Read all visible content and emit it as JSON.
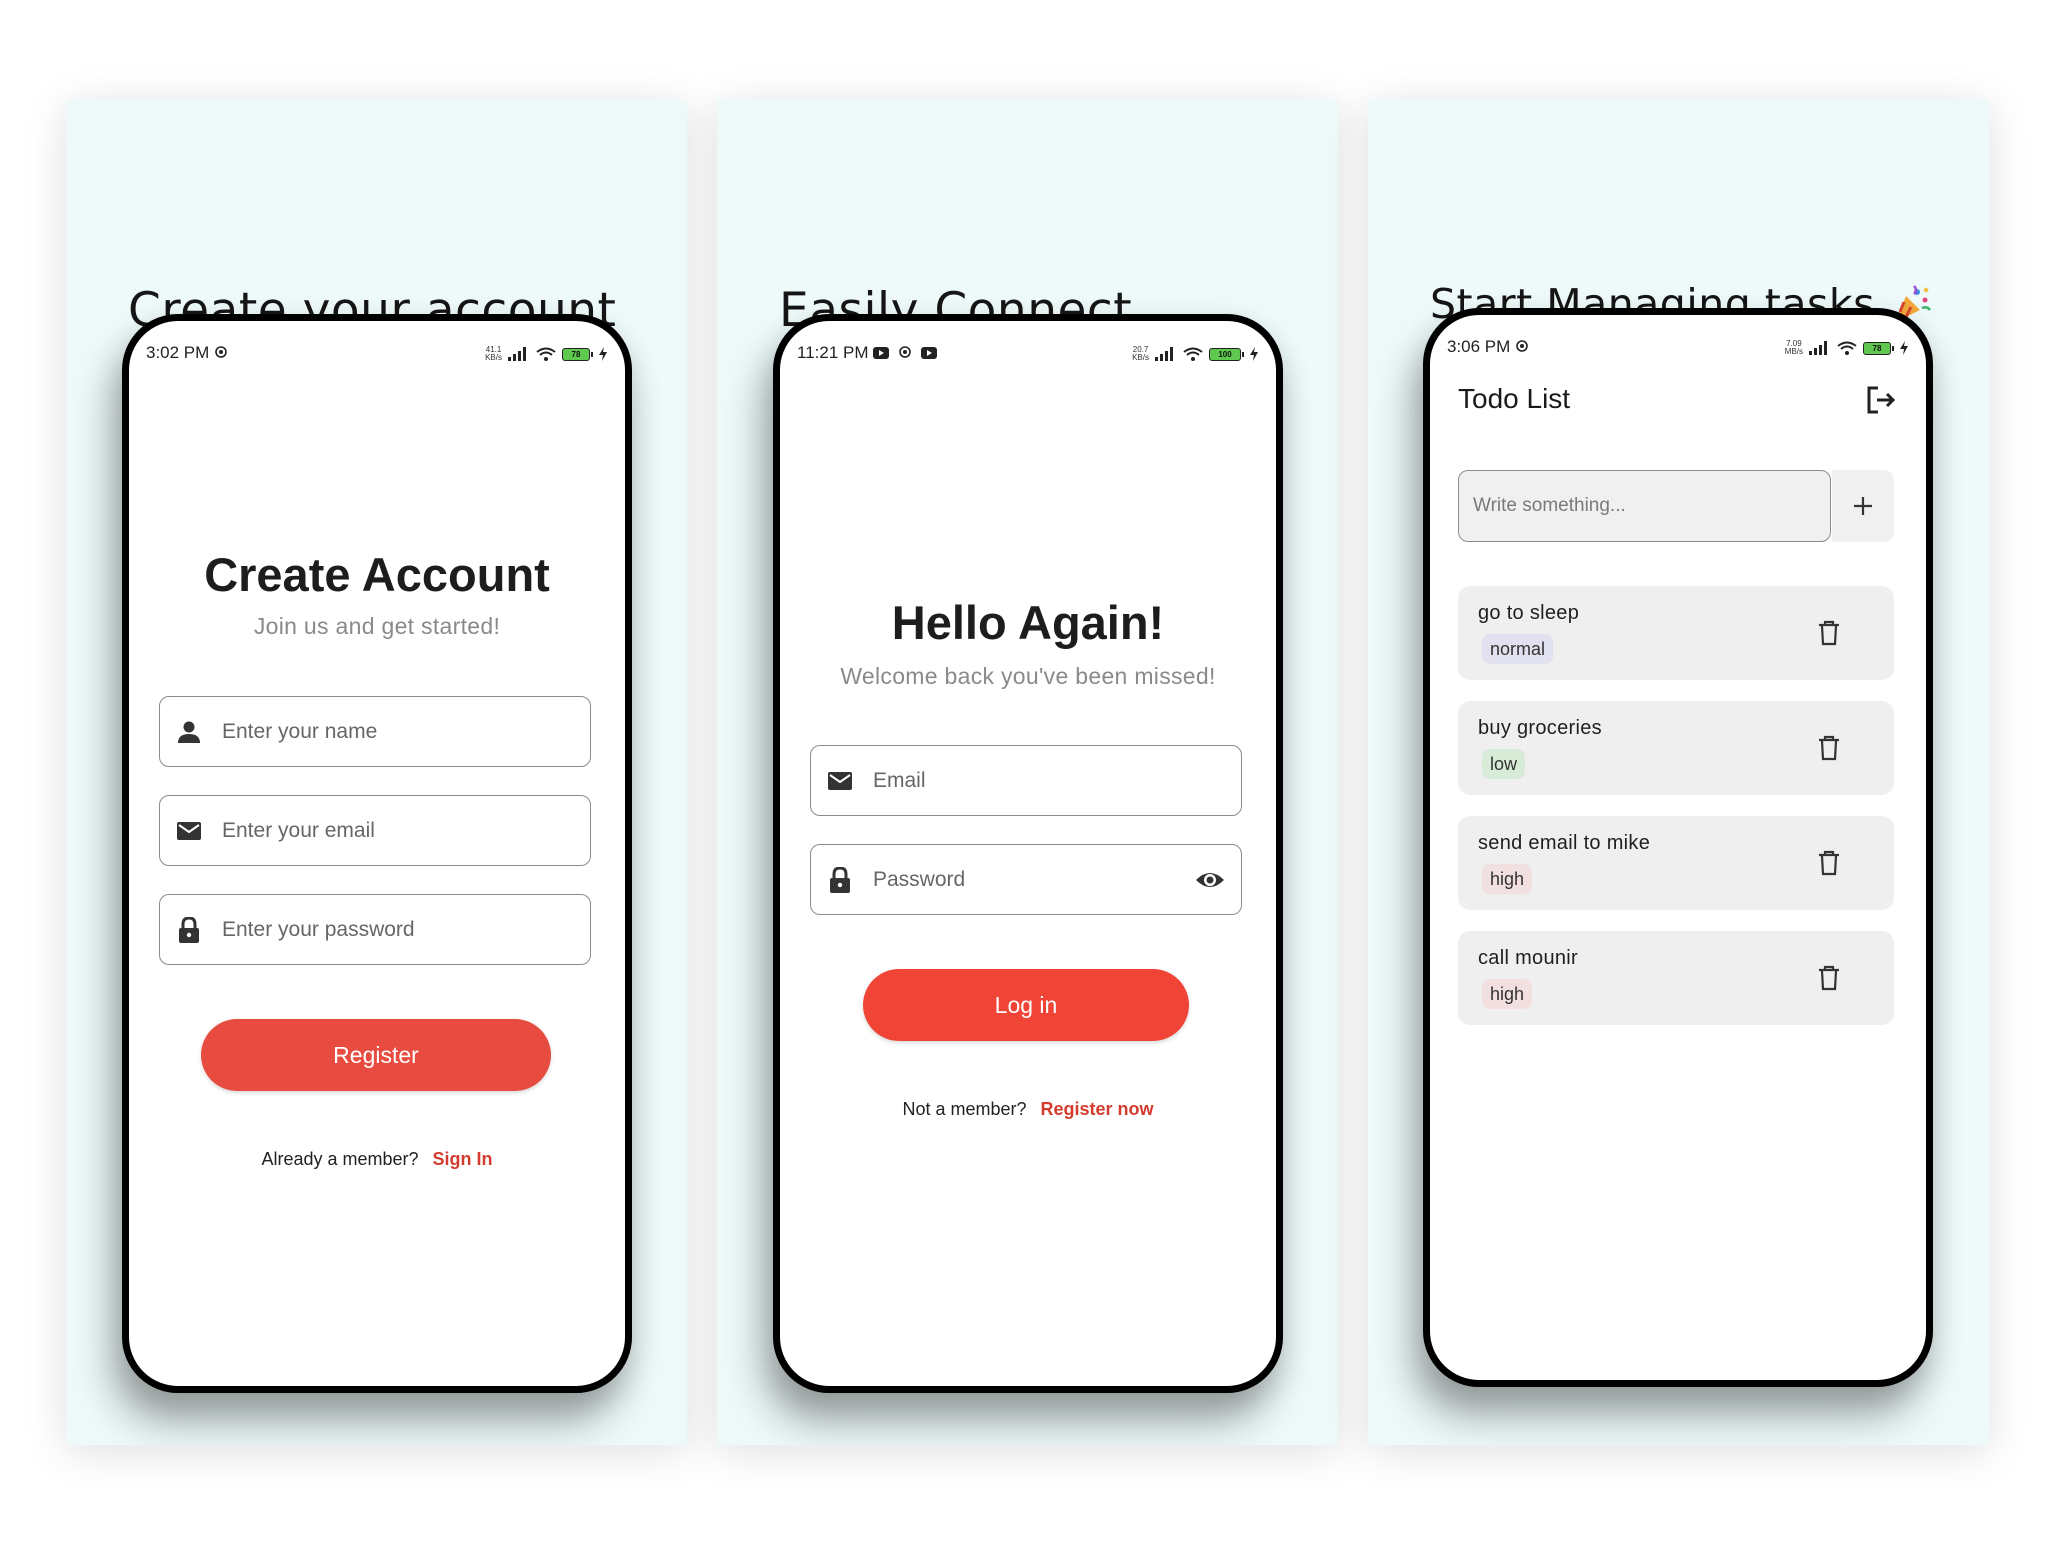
{
  "colors": {
    "panel_bg": "#eefafa",
    "accent_red": "#e84b3f",
    "link_red": "#d43c2f",
    "chip_normal": "#e2e1ef",
    "chip_low": "#d7ebd7",
    "chip_high": "#f2e0e0"
  },
  "panels": [
    {
      "title": "Create your account",
      "status": {
        "time": "3:02 PM",
        "speed_top": "41.1",
        "speed_unit": "KB/s",
        "battery": "78",
        "icons": [
          "gear-icon",
          "signal-icon",
          "wifi-icon",
          "battery-icon",
          "charging-icon"
        ]
      },
      "heading": "Create Account",
      "subheading": "Join us and get started!",
      "fields": [
        {
          "icon": "person-icon",
          "placeholder": "Enter your name"
        },
        {
          "icon": "mail-icon",
          "placeholder": "Enter your email"
        },
        {
          "icon": "lock-icon",
          "placeholder": "Enter your password"
        }
      ],
      "button": "Register",
      "footer_text": "Already a member?",
      "footer_link": "Sign In"
    },
    {
      "title": "Easily Connect",
      "status": {
        "time": "11:21 PM",
        "speed_top": "20.7",
        "speed_unit": "KB/s",
        "battery": "100",
        "icons": [
          "youtube-icon",
          "gear-icon",
          "youtube-icon",
          "signal-icon",
          "wifi-icon",
          "battery-icon",
          "charging-icon"
        ]
      },
      "heading": "Hello Again!",
      "subheading": "Welcome back you've been missed!",
      "fields": [
        {
          "icon": "mail-icon",
          "placeholder": "Email"
        },
        {
          "icon": "lock-icon",
          "placeholder": "Password",
          "trailing_icon": "eye-icon"
        }
      ],
      "button": "Log in",
      "footer_text": "Not a member?",
      "footer_link": "Register now"
    },
    {
      "title": "Start Managing tasks",
      "title_icon": "party-popper-icon",
      "status": {
        "time": "3:06 PM",
        "speed_top": "7.09",
        "speed_unit": "MB/s",
        "battery": "78",
        "icons": [
          "gear-icon",
          "signal-icon",
          "wifi-icon",
          "battery-icon",
          "charging-icon"
        ]
      },
      "app_title": "Todo List",
      "input_placeholder": "Write something...",
      "tasks": [
        {
          "text": "go to sleep",
          "priority": "normal"
        },
        {
          "text": "buy groceries",
          "priority": "low"
        },
        {
          "text": "send email to mike",
          "priority": "high"
        },
        {
          "text": "call mounir",
          "priority": "high"
        }
      ]
    }
  ]
}
